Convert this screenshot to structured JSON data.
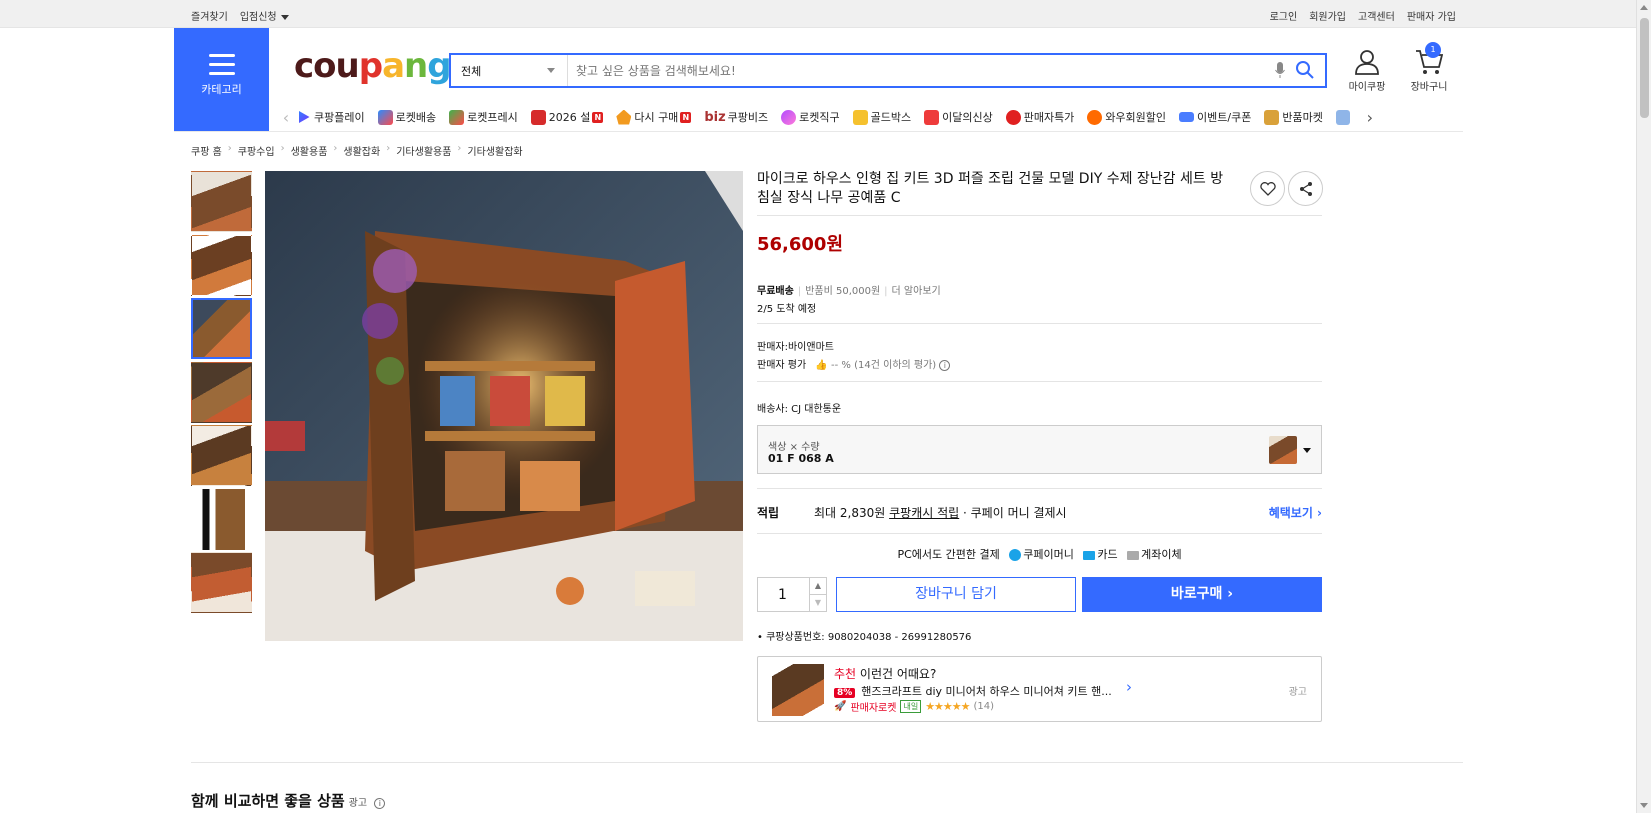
{
  "topbar": {
    "favorites": "즐겨찾기",
    "store_apply": "입점신청",
    "login": "로그인",
    "signup": "회원가입",
    "customer_center": "고객센터",
    "seller_signup": "판매자 가입"
  },
  "header": {
    "category_label": "카테고리",
    "logo": "coupang",
    "search_select": "전체",
    "search_placeholder": "찾고 싶은 상품을 검색해보세요!",
    "mypage": "마이쿠팡",
    "cart": "장바구니",
    "cart_count": "1"
  },
  "gnb": [
    {
      "label": "쿠팡플레이",
      "icon": "play-icon"
    },
    {
      "label": "로켓배송",
      "icon": "rocket-icon"
    },
    {
      "label": "로켓프레시",
      "icon": "rocket-fresh-icon"
    },
    {
      "label": "2026 설",
      "icon": "gift-icon",
      "new": "N"
    },
    {
      "label": "다시 구매",
      "icon": "repurchase-icon",
      "new": "N"
    },
    {
      "label": "쿠팡비즈",
      "icon": "biz-icon",
      "prefix": "biz"
    },
    {
      "label": "로켓직구",
      "icon": "global-icon"
    },
    {
      "label": "골드박스",
      "icon": "goldbox-icon"
    },
    {
      "label": "이달의신상",
      "icon": "new-arrival-icon"
    },
    {
      "label": "판매자특가",
      "icon": "seller-deal-icon"
    },
    {
      "label": "와우회원할인",
      "icon": "wow-icon"
    },
    {
      "label": "이벤트/쿠폰",
      "icon": "coupon-icon"
    },
    {
      "label": "반품마켓",
      "icon": "return-market-icon"
    }
  ],
  "breadcrumb": [
    "쿠팡 홈",
    "쿠팡수입",
    "생활용품",
    "생활잡화",
    "기타생활용품",
    "기타생활잡화"
  ],
  "product": {
    "title": "마이크로 하우스 인형 집 키트 3D 퍼즐 조립 건물 모델 DIY 수제 장난감 세트 방 침실 장식 나무 공예품 C",
    "price": "56,600원",
    "shipping_free": "무료배송",
    "return_fee": "반품비 50,000원",
    "learn_more": "더 알아보기",
    "arrival": "2/5 도착 예정",
    "seller": "판매자:바이앤마트",
    "seller_rating_label": "판매자 평가",
    "seller_rating_value": "-- %",
    "seller_rating_note": "(14건 이하의 평가)",
    "courier": "배송사:  CJ 대한통운",
    "option_label": "색상 × 수량",
    "option_value": "01 F 068 A",
    "reward_label": "적립",
    "reward_prefix": "최대 2,830원",
    "reward_link": "쿠팡캐시 적립",
    "reward_suffix": "· 쿠페이 머니 결제시",
    "benefit_btn": "혜택보기",
    "pay_title": "PC에서도 간편한 결제",
    "pay_methods": [
      "쿠페이머니",
      "카드",
      "계좌이체"
    ],
    "quantity": "1",
    "add_cart": "장바구니 담기",
    "buy_now": "바로구매",
    "product_id": "쿠팡상품번호: 9080204038 - 26991280576"
  },
  "recommend": {
    "tag": "추천",
    "head": "이런건 어때요?",
    "discount": "8%",
    "name": "핸즈크라프트 diy 미니어처 하우스 미니어쳐 키트 핸...",
    "badge": "판매자로켓",
    "naeil": "내일",
    "stars": "★★★★★",
    "review_count": "(14)",
    "ad": "광고"
  },
  "compare": {
    "title": "함께 비교하면 좋을 상품",
    "ad": "광고"
  },
  "colors": {
    "accent": "#346aff",
    "price": "#ae0000"
  }
}
